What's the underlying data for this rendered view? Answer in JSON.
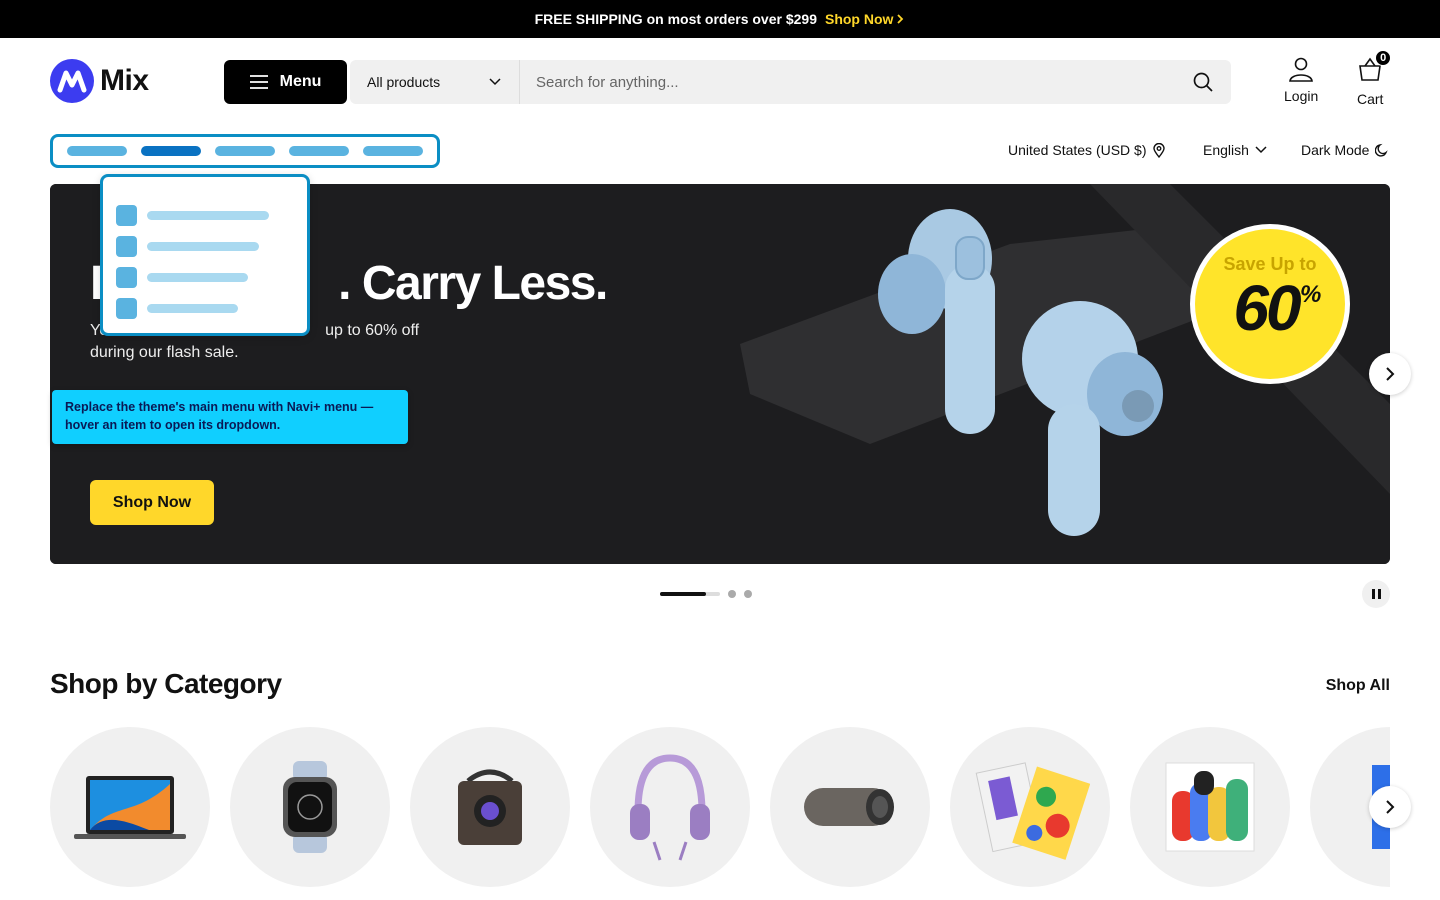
{
  "announcement": {
    "text": "FREE SHIPPING on most orders over $299",
    "cta": "Shop Now"
  },
  "header": {
    "logo_text": "Mix",
    "menu_label": "Menu",
    "search": {
      "category": "All products",
      "placeholder": "Search for anything..."
    },
    "login_label": "Login",
    "cart_label": "Cart",
    "cart_count": "0"
  },
  "utility": {
    "country": "United States (USD $)",
    "language": "English",
    "dark_mode": "Dark Mode"
  },
  "hero": {
    "title_visible": ". Carry Less.",
    "title_first_letter": "H",
    "subtitle_visible_tail": "up to 60% off",
    "subtitle_line2": "during our flash sale.",
    "subtitle_first_letters": "Yo",
    "cta": "Shop Now",
    "badge_top": "Save Up to",
    "badge_value": "60",
    "badge_unit": "%"
  },
  "tooltip": {
    "text": "Replace the theme's main menu with Navi+ menu — hover an item to open its dropdown."
  },
  "slider": {
    "total_slides": 3,
    "active": 1
  },
  "categories": {
    "title": "Shop by Category",
    "shop_all": "Shop All",
    "items": [
      {
        "icon": "laptop-icon"
      },
      {
        "icon": "smartwatch-icon"
      },
      {
        "icon": "projector-icon"
      },
      {
        "icon": "headphones-icon"
      },
      {
        "icon": "speaker-icon"
      },
      {
        "icon": "books-icon"
      },
      {
        "icon": "art-print-icon"
      },
      {
        "icon": "artwork-icon"
      }
    ]
  },
  "colors": {
    "brand": "#3c3cf0",
    "accent_yellow": "#ffd72a",
    "navi_blue": "#0b8ec4",
    "tooltip_cyan": "#10cfff"
  }
}
